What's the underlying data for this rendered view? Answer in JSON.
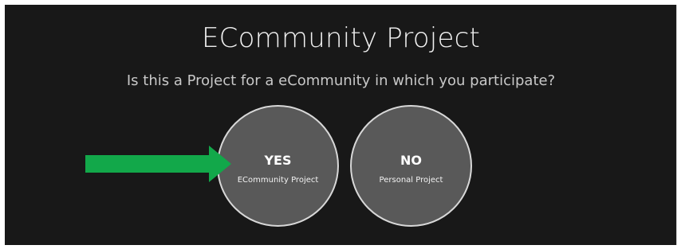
{
  "header": {
    "title": "ECommunity Project",
    "question": "Is this a Project for a eCommunity in which you participate?"
  },
  "options": [
    {
      "label": "YES",
      "sublabel": "ECommunity Project"
    },
    {
      "label": "NO",
      "sublabel": "Personal Project"
    }
  ],
  "colors": {
    "background": "#181818",
    "circle_fill": "#595959",
    "circle_border": "#d8d8d8",
    "arrow": "#12a84a"
  },
  "icons": {
    "pointer": "arrow-right-icon"
  }
}
